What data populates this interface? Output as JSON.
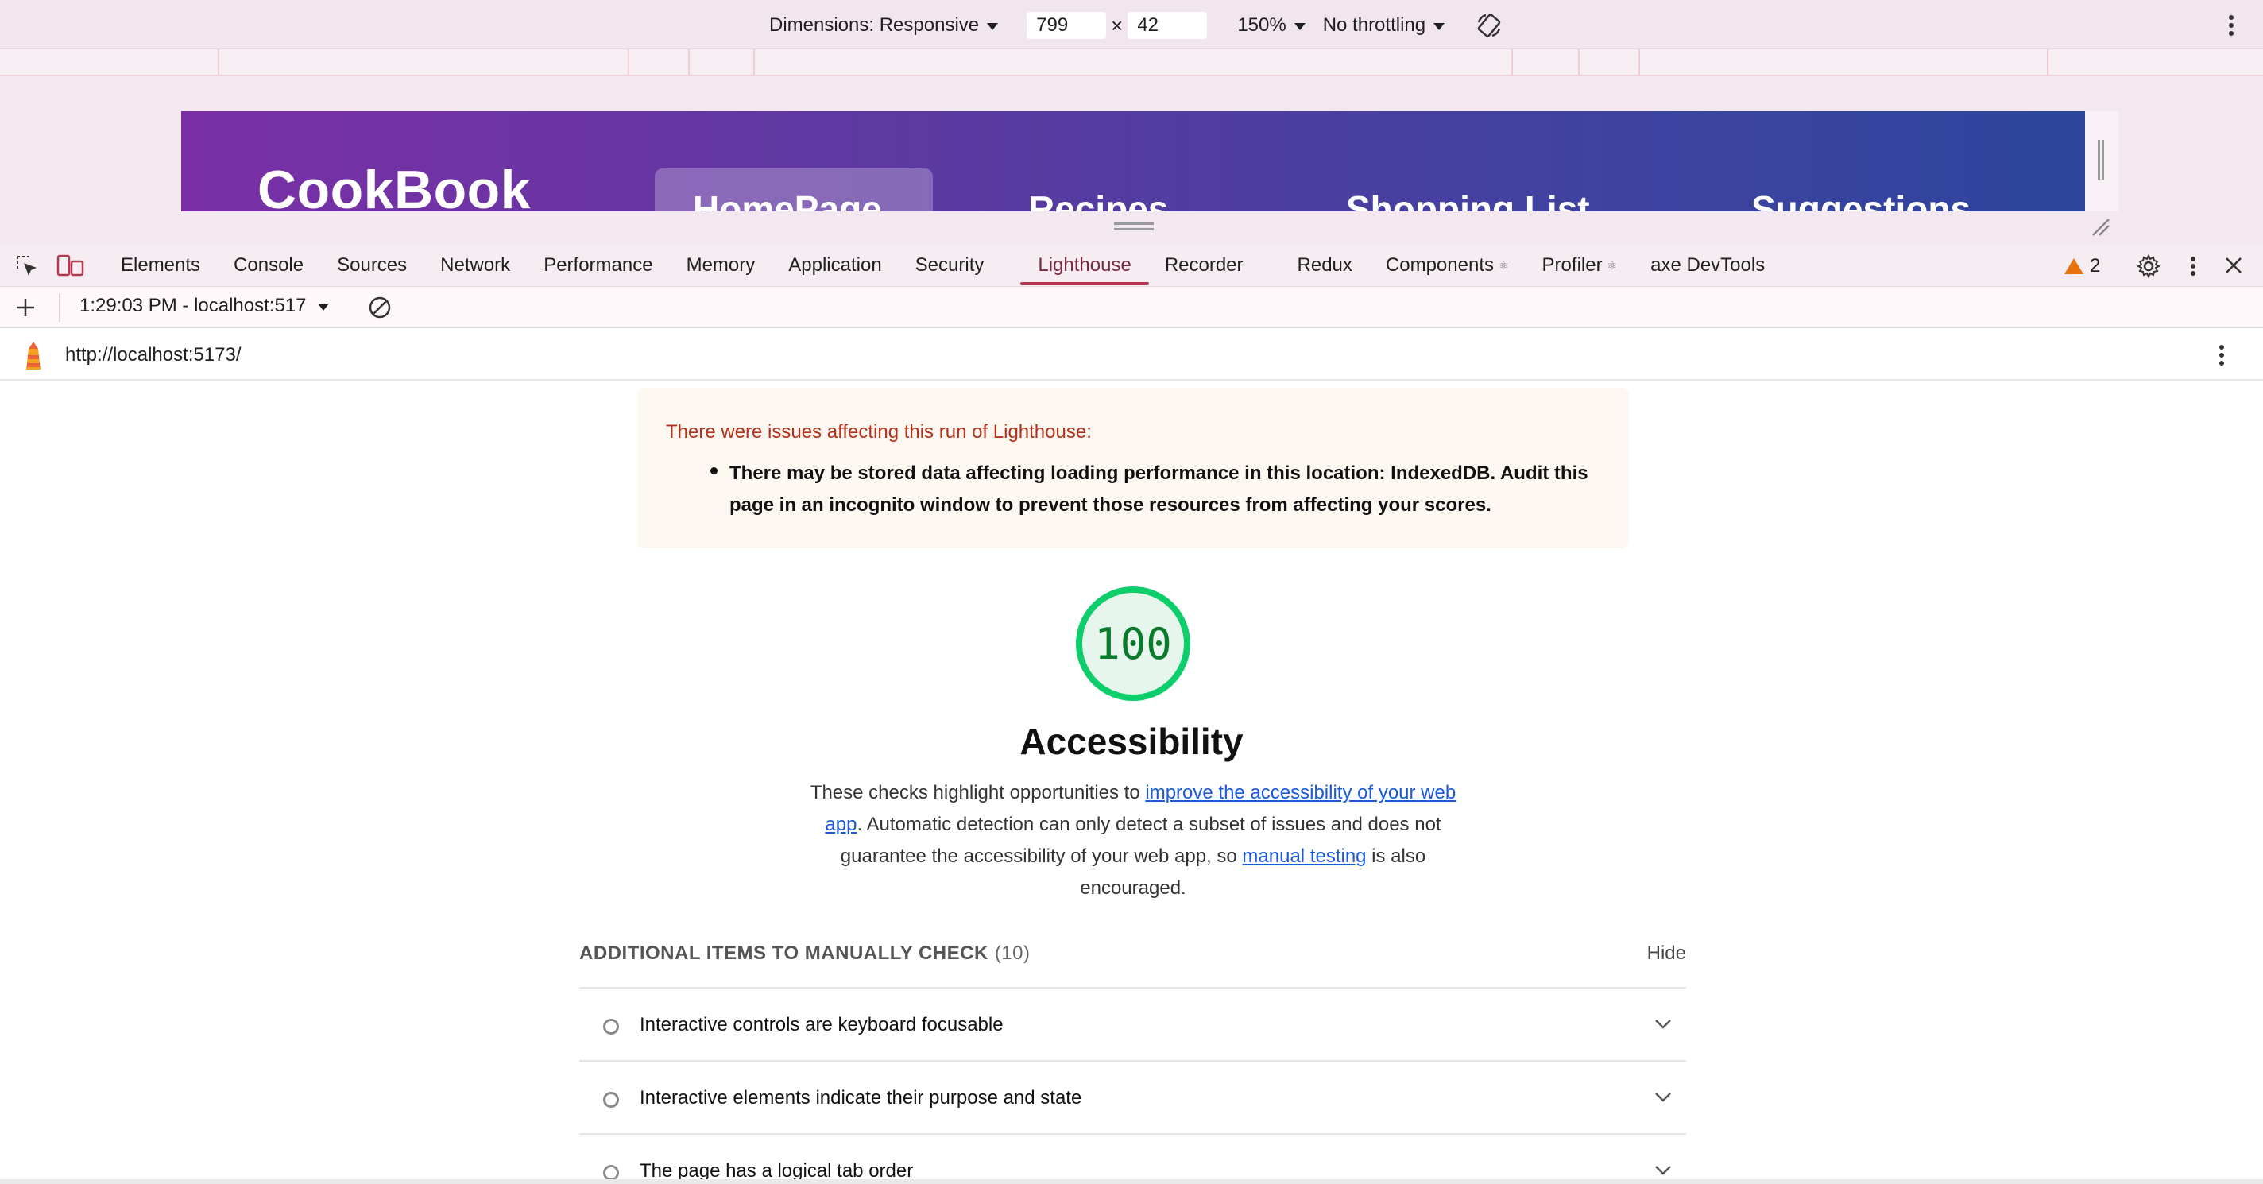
{
  "device_toolbar": {
    "dimensions_label": "Dimensions: Responsive",
    "width_value": "799",
    "height_value": "42",
    "times_sign": "×",
    "zoom": "150%",
    "throttling": "No throttling",
    "rotate_icon": "rotate-icon",
    "more_icon": "more-vertical-icon"
  },
  "emulated_page": {
    "brand": "CookBook",
    "nav": [
      "HomePage",
      "Recipes",
      "Shopping List",
      "Suggestions"
    ]
  },
  "devtools": {
    "tabs": [
      "Elements",
      "Console",
      "Sources",
      "Network",
      "Performance",
      "Memory",
      "Application",
      "Security",
      "Lighthouse",
      "Recorder",
      "Redux",
      "Components",
      "Profiler",
      "axe DevTools"
    ],
    "active_tab": "Lighthouse",
    "components_suffix": "⚛",
    "profiler_suffix": "⚛",
    "warning_count": "2",
    "icons": [
      "inspect-element-icon",
      "device-toolbar-icon",
      "settings-icon",
      "more-vertical-icon",
      "close-icon"
    ]
  },
  "lighthouse_toolbar": {
    "report_select": "1:29:03 PM - localhost:517",
    "url": "http://localhost:5173/"
  },
  "report": {
    "warning_title": "There were issues affecting this run of Lighthouse:",
    "warning_item": "There may be stored data affecting loading performance in this location: IndexedDB. Audit this page in an incognito window to prevent those resources from affecting your scores.",
    "score": "100",
    "score_fraction": 1.0,
    "score_color": "#0cce6b",
    "category_title": "Accessibility",
    "desc_part1": "These checks highlight opportunities to ",
    "desc_link1": "improve the accessibility of your web app",
    "desc_part2": ". Automatic detection can only detect a subset of issues and does not guarantee the accessibility of your web app, so ",
    "desc_link2": "manual testing",
    "desc_part3": " is also encouraged.",
    "group_title": "ADDITIONAL ITEMS TO MANUALLY CHECK",
    "group_count": "(10)",
    "hide_label": "Hide",
    "audits": [
      "Interactive controls are keyboard focusable",
      "Interactive elements indicate their purpose and state",
      "The page has a logical tab order"
    ]
  }
}
